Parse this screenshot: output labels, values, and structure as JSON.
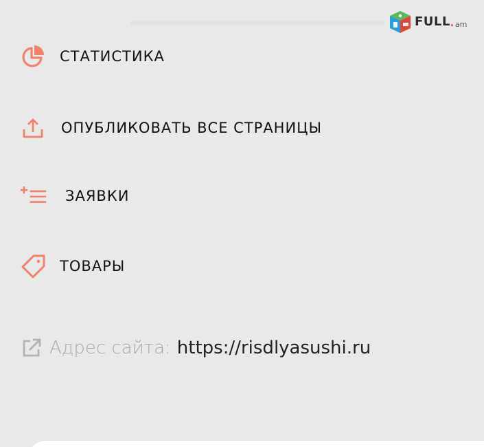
{
  "logo": {
    "brand": "FULL",
    "dot": ".",
    "tld": "am"
  },
  "menu": {
    "items": [
      {
        "label": "СТАТИСТИКА",
        "icon": "pie-chart-icon"
      },
      {
        "label": "ОПУБЛИКОВАТЬ ВСЕ СТРАНИЦЫ",
        "icon": "upload-icon"
      },
      {
        "label": "ЗАЯВКИ",
        "icon": "add-list-icon"
      },
      {
        "label": "ТОВАРЫ",
        "icon": "tag-icon"
      }
    ]
  },
  "site": {
    "label": "Адрес сайта:",
    "url": "https://risdlyasushi.ru",
    "icon": "external-link-icon"
  },
  "colors": {
    "accent": "#f0826c",
    "background": "#e9e9e9",
    "muted": "#a9a9a9"
  }
}
